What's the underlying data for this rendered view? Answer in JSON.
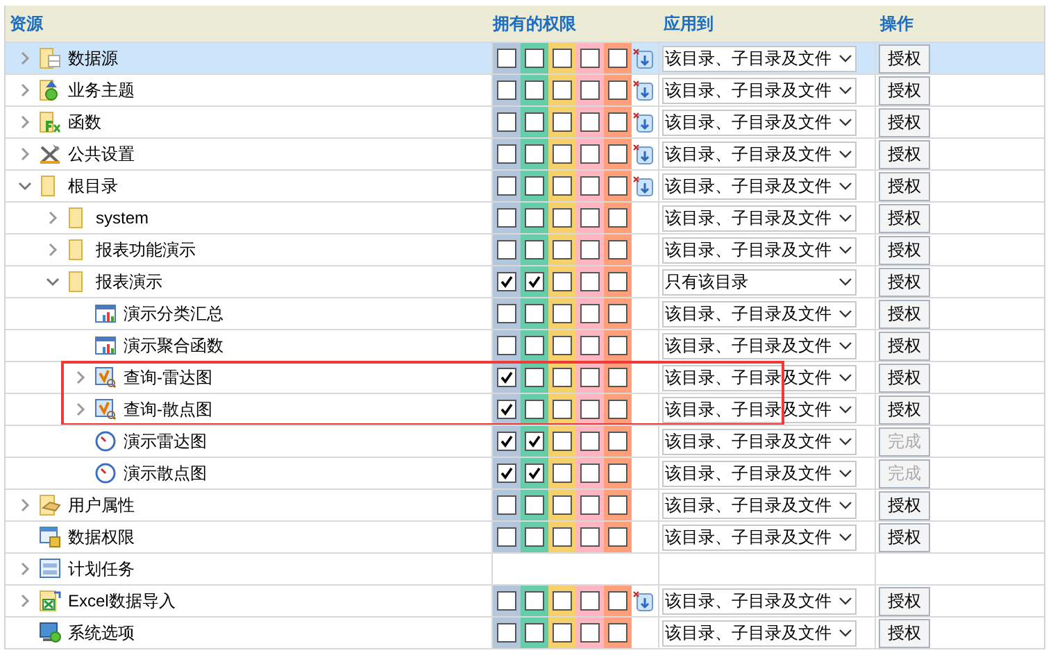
{
  "columns": [
    "资源",
    "拥有的权限",
    "应用到",
    "操作"
  ],
  "rows": [
    {
      "label": "数据源",
      "kind": "datasource",
      "expanded": false,
      "selected": true,
      "highlighted": false,
      "perms": [
        false,
        false,
        false,
        false,
        false
      ],
      "clear_icon": true,
      "apply_to": "该目录、子目录及文件",
      "action": "授权",
      "action_disabled": false
    },
    {
      "label": "业务主题",
      "kind": "subject",
      "expanded": false,
      "selected": false,
      "highlighted": false,
      "perms": [
        false,
        false,
        false,
        false,
        false
      ],
      "clear_icon": true,
      "apply_to": "该目录、子目录及文件",
      "action": "授权",
      "action_disabled": false
    },
    {
      "label": "函数",
      "kind": "function",
      "expanded": false,
      "selected": false,
      "highlighted": false,
      "perms": [
        false,
        false,
        false,
        false,
        false
      ],
      "clear_icon": true,
      "apply_to": "该目录、子目录及文件",
      "action": "授权",
      "action_disabled": false
    },
    {
      "label": "公共设置",
      "kind": "settings",
      "expanded": false,
      "selected": false,
      "highlighted": false,
      "perms": [
        false,
        false,
        false,
        false,
        false
      ],
      "clear_icon": true,
      "apply_to": "该目录、子目录及文件",
      "action": "授权",
      "action_disabled": false
    },
    {
      "label": "根目录",
      "kind": "folder",
      "expanded": true,
      "selected": false,
      "highlighted": false,
      "perms": [
        false,
        false,
        false,
        false,
        false
      ],
      "clear_icon": true,
      "apply_to": "该目录、子目录及文件",
      "action": "授权",
      "action_disabled": false,
      "children": [
        {
          "label": "system",
          "kind": "folder",
          "expanded": false,
          "selected": false,
          "highlighted": false,
          "perms": [
            false,
            false,
            false,
            false,
            false
          ],
          "clear_icon": false,
          "apply_to": "该目录、子目录及文件",
          "action": "授权",
          "action_disabled": false
        },
        {
          "label": "报表功能演示",
          "kind": "folder",
          "expanded": false,
          "selected": false,
          "highlighted": false,
          "perms": [
            false,
            false,
            false,
            false,
            false
          ],
          "clear_icon": false,
          "apply_to": "该目录、子目录及文件",
          "action": "授权",
          "action_disabled": false
        },
        {
          "label": "报表演示",
          "kind": "folder",
          "expanded": true,
          "selected": false,
          "highlighted": false,
          "perms": [
            true,
            true,
            false,
            false,
            false
          ],
          "clear_icon": false,
          "apply_to": "只有该目录",
          "action": "授权",
          "action_disabled": false,
          "children": [
            {
              "label": "演示分类汇总",
              "kind": "report",
              "selected": false,
              "highlighted": false,
              "perms": [
                false,
                false,
                false,
                false,
                false
              ],
              "clear_icon": false,
              "apply_to": "该目录、子目录及文件",
              "action": "授权",
              "action_disabled": false
            },
            {
              "label": "演示聚合函数",
              "kind": "report",
              "selected": false,
              "highlighted": false,
              "perms": [
                false,
                false,
                false,
                false,
                false
              ],
              "clear_icon": false,
              "apply_to": "该目录、子目录及文件",
              "action": "授权",
              "action_disabled": false
            },
            {
              "label": "查询-雷达图",
              "kind": "query",
              "expanded": false,
              "selected": false,
              "highlighted": true,
              "perms": [
                true,
                false,
                false,
                false,
                false
              ],
              "clear_icon": false,
              "apply_to": "该目录、子目录及文件",
              "action": "授权",
              "action_disabled": false
            },
            {
              "label": "查询-散点图",
              "kind": "query",
              "expanded": false,
              "selected": false,
              "highlighted": true,
              "perms": [
                true,
                false,
                false,
                false,
                false
              ],
              "clear_icon": false,
              "apply_to": "该目录、子目录及文件",
              "action": "授权",
              "action_disabled": false
            },
            {
              "label": "演示雷达图",
              "kind": "dashboard",
              "selected": false,
              "highlighted": false,
              "perms": [
                true,
                true,
                false,
                false,
                false
              ],
              "clear_icon": false,
              "apply_to": "该目录、子目录及文件",
              "action": "完成",
              "action_disabled": true
            },
            {
              "label": "演示散点图",
              "kind": "dashboard",
              "selected": false,
              "highlighted": false,
              "perms": [
                true,
                true,
                false,
                false,
                false
              ],
              "clear_icon": false,
              "apply_to": "该目录、子目录及文件",
              "action": "完成",
              "action_disabled": true
            }
          ]
        }
      ]
    },
    {
      "label": "用户属性",
      "kind": "user-attr",
      "expanded": false,
      "selected": false,
      "highlighted": false,
      "perms": [
        false,
        false,
        false,
        false,
        false
      ],
      "clear_icon": false,
      "apply_to": "该目录、子目录及文件",
      "action": "授权",
      "action_disabled": false
    },
    {
      "label": "数据权限",
      "kind": "data-perm",
      "selected": false,
      "highlighted": false,
      "perms": [
        false,
        false,
        false,
        false,
        false
      ],
      "clear_icon": false,
      "apply_to": "该目录、子目录及文件",
      "action": "授权",
      "action_disabled": false
    },
    {
      "label": "计划任务",
      "kind": "schedule",
      "expanded": false,
      "selected": false,
      "highlighted": false
    },
    {
      "label": "Excel数据导入",
      "kind": "excel",
      "expanded": false,
      "selected": false,
      "highlighted": false,
      "perms": [
        false,
        false,
        false,
        false,
        false
      ],
      "clear_icon": true,
      "apply_to": "该目录、子目录及文件",
      "action": "授权",
      "action_disabled": false
    },
    {
      "label": "系统选项",
      "kind": "system",
      "selected": false,
      "highlighted": false,
      "perms": [
        false,
        false,
        false,
        false,
        false
      ],
      "clear_icon": false,
      "apply_to": "该目录、子目录及文件",
      "action": "授权",
      "action_disabled": false
    }
  ]
}
